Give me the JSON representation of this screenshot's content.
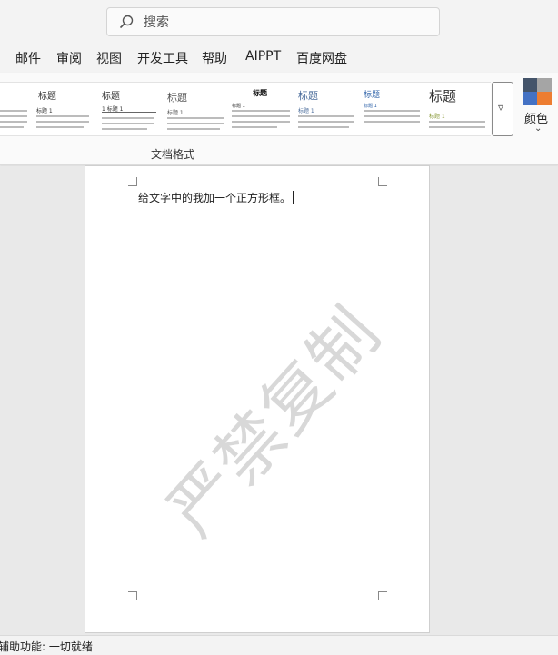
{
  "search": {
    "placeholder": "搜索"
  },
  "menu": {
    "tabs": [
      "邮件",
      "审阅",
      "视图",
      "开发工具",
      "帮助",
      "AIPPT",
      "百度网盘"
    ]
  },
  "ribbon": {
    "styles": [
      {
        "title": "",
        "heading": ""
      },
      {
        "title": "标题",
        "heading": "标题 1"
      },
      {
        "title": "标题",
        "heading": "1  标题 1"
      },
      {
        "title": "标题",
        "heading": "标题 1"
      },
      {
        "title": "标题",
        "heading": "标题 1"
      },
      {
        "title": "标题",
        "heading": "标题 1"
      },
      {
        "title": "标题",
        "heading": "标题 1"
      },
      {
        "title": "标题",
        "heading": "标题 1"
      }
    ],
    "more_icon": "▿",
    "colors_label": "颜色",
    "colors_chevron": "⌄",
    "group_label": "文档格式",
    "palette": [
      "#44546a",
      "#a5a5a5",
      "#4472c4",
      "#ed7d31"
    ]
  },
  "document": {
    "body_text": "给文字中的我加一个正方形框。",
    "watermark": "严禁复制"
  },
  "status": {
    "accessibility": "辅助功能: 一切就绪"
  }
}
